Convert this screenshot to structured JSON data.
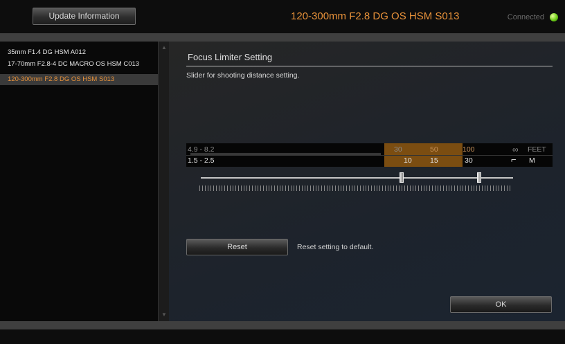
{
  "header": {
    "update_button": "Update Information",
    "lens_title": "120-300mm F2.8 DG OS HSM S013",
    "status": "Connected",
    "status_color": "#6fce1a",
    "accent_color": "#e8923a"
  },
  "sidebar": {
    "items": [
      {
        "label": "35mm F1.4 DG HSM A012",
        "selected": false
      },
      {
        "label": "17-70mm F2.8-4 DC MACRO OS HSM C013",
        "selected": false
      },
      {
        "label": "120-300mm F2.8 DG OS HSM S013",
        "selected": true
      }
    ]
  },
  "main": {
    "section_title": "Focus Limiter Setting",
    "section_desc": "Slider for shooting distance setting.",
    "scale": {
      "feet_row": {
        "min_range": "4.9 - 8.2",
        "ticks": [
          "30",
          "50",
          "100"
        ],
        "infinity": "∞",
        "unit": "FEET"
      },
      "meter_row": {
        "min_range": "1.5 - 2.5",
        "ticks": [
          "10",
          "15",
          "30"
        ],
        "corner": "⌐",
        "unit": "M"
      }
    },
    "slider": {
      "min_value": "30",
      "max_value": "30"
    },
    "reset_button": "Reset",
    "reset_desc": "Reset setting to default.",
    "ok_button": "OK"
  }
}
